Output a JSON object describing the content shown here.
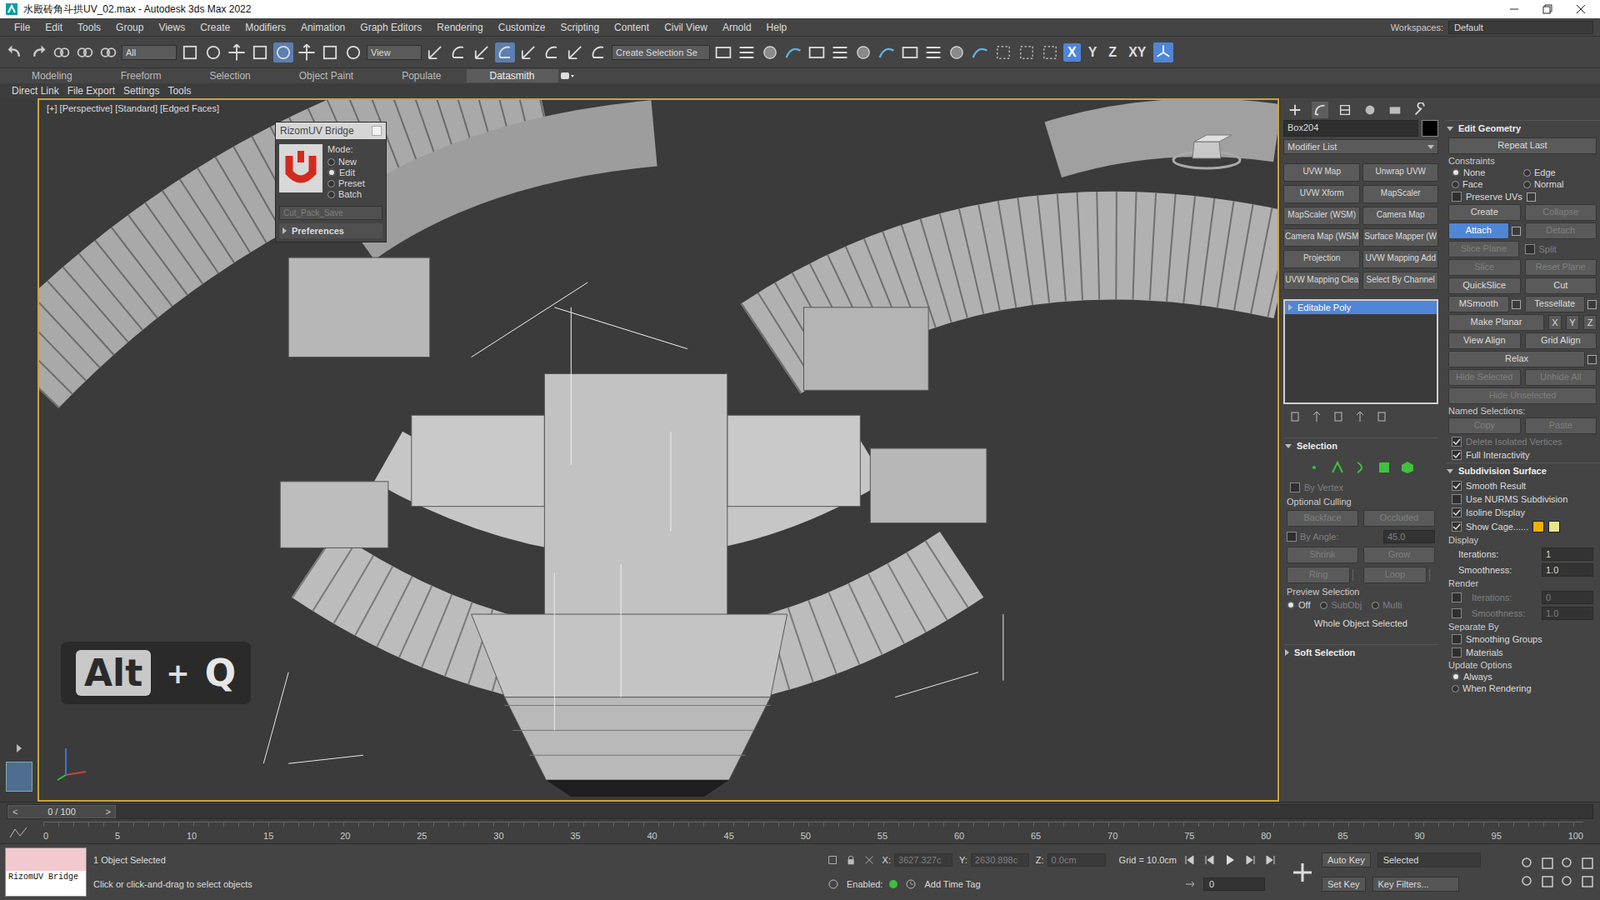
{
  "window": {
    "title": "水殿砖角斗拱UV_02.max - Autodesk 3ds Max 2022"
  },
  "menu": [
    "File",
    "Edit",
    "Tools",
    "Group",
    "Views",
    "Create",
    "Modifiers",
    "Animation",
    "Graph Editors",
    "Rendering",
    "Customize",
    "Scripting",
    "Content",
    "Civil View",
    "Arnold",
    "Help"
  ],
  "workspace": {
    "label": "Workspaces:",
    "value": "Default"
  },
  "toolbar": {
    "filter": "All",
    "coord": "View",
    "named_selection": "Create Selection Se",
    "axes": [
      {
        "label": "X",
        "selected": true
      },
      {
        "label": "Y",
        "selected": false
      },
      {
        "label": "Z",
        "selected": false
      },
      {
        "label": "XY",
        "selected": false
      }
    ]
  },
  "ribbon": {
    "tabs": [
      {
        "label": "Modeling",
        "selected": false
      },
      {
        "label": "Freeform",
        "selected": false
      },
      {
        "label": "Selection",
        "selected": false
      },
      {
        "label": "Object Paint",
        "selected": false
      },
      {
        "label": "Populate",
        "selected": false
      },
      {
        "label": "Datasmith",
        "selected": true
      }
    ],
    "subtabs": [
      "Direct Link",
      "File Export",
      "Settings",
      "Tools"
    ]
  },
  "viewport": {
    "label": "[+] [Perspective] [Standard] [Edged Faces]",
    "shortcut": [
      "Alt",
      "+",
      "Q"
    ]
  },
  "rizom": {
    "title": "RizomUV Bridge",
    "mode_label": "Mode:",
    "modes": [
      {
        "label": "New",
        "selected": false
      },
      {
        "label": "Edit",
        "selected": true
      },
      {
        "label": "Preset",
        "selected": false
      },
      {
        "label": "Batch",
        "selected": false
      }
    ],
    "preset": "Cut_Pack_Save",
    "preset_disabled": true,
    "preferences": "Preferences"
  },
  "command_panel": {
    "tabs": [
      {
        "selected": false
      },
      {
        "selected": true
      },
      {
        "selected": false
      },
      {
        "selected": false
      },
      {
        "selected": false
      },
      {
        "selected": false
      }
    ],
    "object_name": "Box204",
    "modifier_list": "Modifier List",
    "modifier_buttons": [
      "UVW Map",
      "Unwrap UVW",
      "UVW Xform",
      "MapScaler",
      "MapScaler (WSM)",
      "Camera Map",
      "Camera Map (WSM",
      "Surface Mapper (W",
      "Projection",
      "UVW Mapping Add",
      "UVW Mapping Clea",
      "Select By Channel"
    ],
    "stack": [
      {
        "label": "Editable Poly",
        "selected": true,
        "expanded": false
      }
    ]
  },
  "selection": {
    "title": "Selection",
    "expanded": true,
    "by_vertex": {
      "label": "By Vertex",
      "checked": false,
      "disabled": true
    },
    "culling_label": "Optional Culling",
    "culling": [
      {
        "label": "Backface",
        "disabled": true
      },
      {
        "label": "Occluded",
        "disabled": true
      }
    ],
    "by_angle": {
      "label": "By Angle:",
      "value": "45.0",
      "checked": false,
      "disabled": true
    },
    "buttons": [
      {
        "label": "Shrink",
        "disabled": true
      },
      {
        "label": "Grow",
        "disabled": true
      },
      {
        "label": "Ring",
        "disabled": true
      },
      {
        "label": "Loop",
        "disabled": true
      }
    ],
    "preview_label": "Preview Selection",
    "preview": [
      {
        "label": "Off",
        "selected": true,
        "disabled": false
      },
      {
        "label": "SubObj",
        "selected": false,
        "disabled": true
      },
      {
        "label": "Multi",
        "selected": false,
        "disabled": true
      }
    ],
    "status": "Whole Object Selected"
  },
  "soft_selection": {
    "title": "Soft Selection",
    "expanded": false
  },
  "edit_geometry": {
    "title": "Edit Geometry",
    "expanded": true,
    "repeat_last": "Repeat Last",
    "constraints_label": "Constraints",
    "constraints": [
      {
        "label": "None",
        "selected": true
      },
      {
        "label": "Edge",
        "selected": false
      },
      {
        "label": "Face",
        "selected": false
      },
      {
        "label": "Normal",
        "selected": false
      }
    ],
    "preserve_uvs": {
      "label": "Preserve UVs",
      "checked": false
    },
    "rows": [
      [
        {
          "kind": "button",
          "label": "Create",
          "disabled": false,
          "active": false,
          "settings": false,
          "checked": false
        },
        {
          "kind": "button",
          "label": "Collapse",
          "disabled": true,
          "active": false,
          "settings": false,
          "checked": false
        }
      ],
      [
        {
          "kind": "button",
          "label": "Attach",
          "disabled": false,
          "active": true,
          "settings": true,
          "checked": false
        },
        {
          "kind": "button",
          "label": "Detach",
          "disabled": true,
          "active": false,
          "settings": false,
          "checked": false
        }
      ],
      [
        {
          "kind": "button",
          "label": "Slice Plane",
          "disabled": true,
          "active": false,
          "settings": false,
          "checked": false
        },
        {
          "kind": "checkbox",
          "label": "Split",
          "disabled": true,
          "active": false,
          "settings": false,
          "checked": false
        }
      ],
      [
        {
          "kind": "button",
          "label": "Slice",
          "disabled": true,
          "active": false,
          "settings": false,
          "checked": false
        },
        {
          "kind": "button",
          "label": "Reset Plane",
          "disabled": true,
          "active": false,
          "settings": false,
          "checked": false
        }
      ],
      [
        {
          "kind": "button",
          "label": "QuickSlice",
          "disabled": false,
          "active": false,
          "settings": false,
          "checked": false
        },
        {
          "kind": "button",
          "label": "Cut",
          "disabled": false,
          "active": false,
          "settings": false,
          "checked": false
        }
      ],
      [
        {
          "kind": "button",
          "label": "MSmooth",
          "disabled": false,
          "active": false,
          "settings": true,
          "checked": false
        },
        {
          "kind": "button",
          "label": "Tessellate",
          "disabled": false,
          "active": false,
          "settings": true,
          "checked": false
        }
      ],
      [
        {
          "kind": "button",
          "label": "Make Planar",
          "disabled": false,
          "active": false,
          "settings": false,
          "checked": false
        },
        {
          "kind": "axis",
          "label": "X",
          "disabled": false,
          "active": false,
          "settings": false,
          "checked": false
        },
        {
          "kind": "axis",
          "label": "Y",
          "disabled": false,
          "active": false,
          "settings": false,
          "checked": false
        },
        {
          "kind": "axis",
          "label": "Z",
          "disabled": false,
          "active": false,
          "settings": false,
          "checked": false
        }
      ],
      [
        {
          "kind": "button",
          "label": "View Align",
          "disabled": false,
          "active": false,
          "settings": false,
          "checked": false
        },
        {
          "kind": "button",
          "label": "Grid Align",
          "disabled": false,
          "active": false,
          "settings": false,
          "checked": false
        }
      ],
      [
        {
          "kind": "button",
          "label": "Relax",
          "disabled": false,
          "active": false,
          "settings": true,
          "checked": false
        }
      ],
      [
        {
          "kind": "button",
          "label": "Hide Selected",
          "disabled": true,
          "active": false,
          "settings": false,
          "checked": false
        },
        {
          "kind": "button",
          "label": "Unhide All",
          "disabled": true,
          "active": false,
          "settings": false,
          "checked": false
        }
      ],
      [
        {
          "kind": "button",
          "label": "Hide Unselected",
          "disabled": true,
          "active": false,
          "settings": false,
          "checked": false
        }
      ]
    ],
    "named_label": "Named Selections:",
    "named_buttons": [
      {
        "label": "Copy",
        "disabled": true
      },
      {
        "label": "Paste",
        "disabled": true
      }
    ],
    "checks": [
      {
        "label": "Delete Isolated Vertices",
        "checked": true,
        "disabled": true
      },
      {
        "label": "Full Interactivity",
        "checked": true,
        "disabled": false
      }
    ]
  },
  "subdivision": {
    "title": "Subdivision Surface",
    "expanded": true,
    "checks": [
      {
        "label": "Smooth Result",
        "checked": true
      },
      {
        "label": "Use NURMS Subdivision",
        "checked": false
      },
      {
        "label": "Isoline Display",
        "checked": true
      },
      {
        "label": "Show Cage......",
        "checked": true
      }
    ],
    "cage_colors": [
      {
        "color": "#f0b000"
      },
      {
        "color": "#e6e68c"
      }
    ],
    "display": {
      "label": "Display",
      "fields": [
        {
          "label": "Iterations:",
          "value": "1",
          "disabled": false,
          "checked": false
        },
        {
          "label": "Smoothness:",
          "value": "1.0",
          "disabled": false,
          "checked": false
        }
      ]
    },
    "render": {
      "label": "Render",
      "fields": [
        {
          "label": "Iterations:",
          "value": "0",
          "disabled": true,
          "checked": false
        },
        {
          "label": "Smoothness:",
          "value": "1.0",
          "disabled": true,
          "checked": false
        }
      ]
    },
    "separate_label": "Separate By",
    "separate": [
      {
        "label": "Smoothing Groups",
        "checked": false
      },
      {
        "label": "Materials",
        "checked": false
      }
    ],
    "update_label": "Update Options",
    "update": [
      {
        "label": "Always",
        "selected": true
      },
      {
        "label": "When Rendering",
        "selected": false
      }
    ]
  },
  "timeline": {
    "frame": "0 / 100",
    "prev": "<",
    "next": ">",
    "level": 0,
    "ticks": [
      "0",
      "5",
      "10",
      "15",
      "20",
      "25",
      "30",
      "35",
      "40",
      "45",
      "50",
      "55",
      "60",
      "65",
      "70",
      "75",
      "80",
      "85",
      "90",
      "95",
      "100"
    ]
  },
  "status": {
    "listener": "RizomUV Bridge",
    "selection": "1 Object Selected",
    "prompt": "Click or click-and-drag to select objects",
    "coords": [
      {
        "label": "X:",
        "value": "3627.327c"
      },
      {
        "label": "Y:",
        "value": "2630.898c"
      },
      {
        "label": "Z:",
        "value": "0.0cm"
      }
    ],
    "grid": "Grid = 10.0cm",
    "enabled": {
      "label": "Enabled:",
      "on": true
    },
    "time_tag": "Add Time Tag",
    "frame": "0",
    "auto_key": "Auto Key",
    "key_mode": "Selected",
    "set_key": "Set Key",
    "key_filters": "Key Filters..."
  }
}
